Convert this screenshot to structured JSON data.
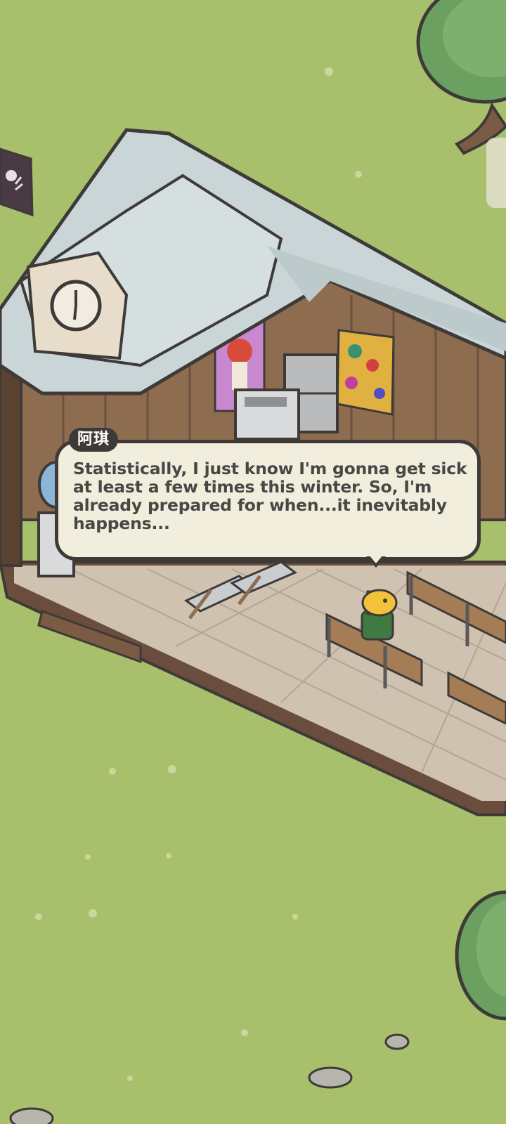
{
  "dialog": {
    "speaker": "阿琪",
    "text": "Statistically, I just know I'm gonna get sick at least a few times this winter. So, I'm already prepared for when...it inevitably happens..."
  },
  "colors": {
    "grass": "#a8bf6c",
    "roof_snow": "#c9d5d6",
    "wood_wall": "#8e6c4f",
    "floor_tile": "#cfc2b0",
    "dialog_bg": "#f2eedd",
    "dialog_border": "#3e3a38"
  },
  "icons": [
    "clock-icon",
    "flag-icon",
    "tree-icon",
    "bench-icon",
    "giraffe-character"
  ]
}
